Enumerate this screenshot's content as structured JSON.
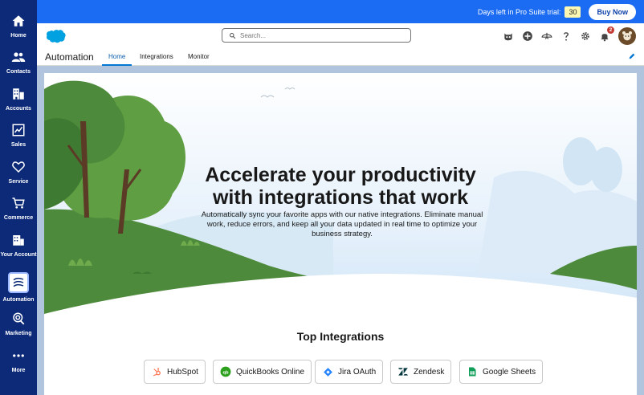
{
  "nav": {
    "items": [
      {
        "label": "Home",
        "icon": "home-icon"
      },
      {
        "label": "Contacts",
        "icon": "contacts-icon"
      },
      {
        "label": "Accounts",
        "icon": "accounts-icon"
      },
      {
        "label": "Sales",
        "icon": "sales-icon"
      },
      {
        "label": "Service",
        "icon": "heart-icon"
      },
      {
        "label": "Commerce",
        "icon": "cart-icon"
      },
      {
        "label": "Your Account",
        "icon": "building-icon"
      },
      {
        "label": "Automation",
        "icon": "automation-icon"
      },
      {
        "label": "Marketing",
        "icon": "marketing-icon"
      },
      {
        "label": "More",
        "icon": "more-icon"
      }
    ]
  },
  "banner": {
    "trial_text": "Days left in Pro Suite trial:",
    "days_left": "30",
    "buy_label": "Buy Now"
  },
  "header": {
    "search_placeholder": "Search...",
    "notification_count": "2"
  },
  "tabbar": {
    "app_name": "Automation",
    "tabs": [
      {
        "label": "Home"
      },
      {
        "label": "Integrations"
      },
      {
        "label": "Monitor"
      }
    ]
  },
  "hero": {
    "title_line1": "Accelerate your productivity",
    "title_line2": "with integrations that work",
    "description": "Automatically sync your favorite apps with our native integrations. Eliminate manual work, reduce errors, and keep all your data updated in real time to optimize your business strategy."
  },
  "integrations": {
    "title": "Top Integrations",
    "items": [
      {
        "label": "HubSpot"
      },
      {
        "label": "QuickBooks Online"
      },
      {
        "label": "Jira OAuth"
      },
      {
        "label": "Zendesk"
      },
      {
        "label": "Google Sheets"
      }
    ]
  },
  "colors": {
    "nav_bg": "#0c2a78",
    "banner_bg": "#1b6cf2",
    "accent": "#0176d3"
  }
}
